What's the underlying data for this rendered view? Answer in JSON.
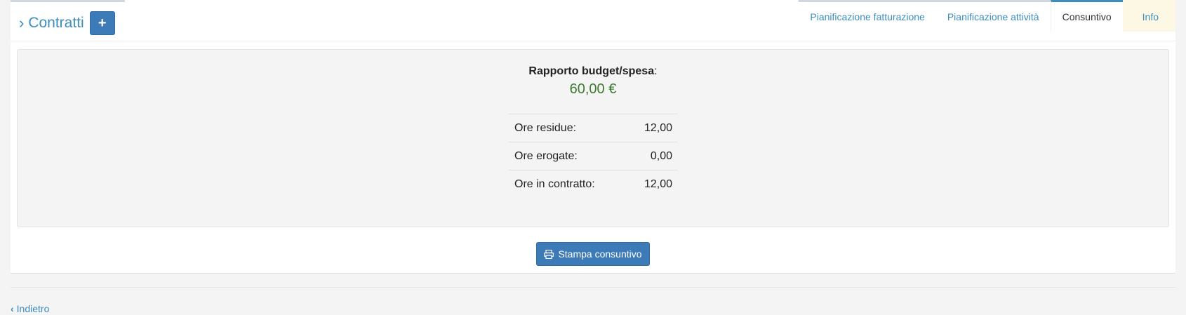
{
  "header": {
    "title": "Contratti",
    "add_label": "+"
  },
  "tabs": [
    {
      "label": "Pianificazione fatturazione"
    },
    {
      "label": "Pianificazione attività"
    },
    {
      "label": "Consuntivo"
    },
    {
      "label": "Info"
    }
  ],
  "summary": {
    "ratio_label": "Rapporto budget/spesa",
    "ratio_value": "60,00 €",
    "rows": [
      {
        "label": "Ore residue:",
        "value": "12,00"
      },
      {
        "label": "Ore erogate:",
        "value": "0,00"
      },
      {
        "label": "Ore in contratto:",
        "value": "12,00"
      }
    ]
  },
  "actions": {
    "print_label": "Stampa consuntivo"
  },
  "footer": {
    "back_label": "Indietro"
  },
  "colors": {
    "accent": "#3c8dbc",
    "button": "#3c7ab8",
    "success_text": "#3d7a2e",
    "info_tab_bg": "#fcf8e3"
  }
}
